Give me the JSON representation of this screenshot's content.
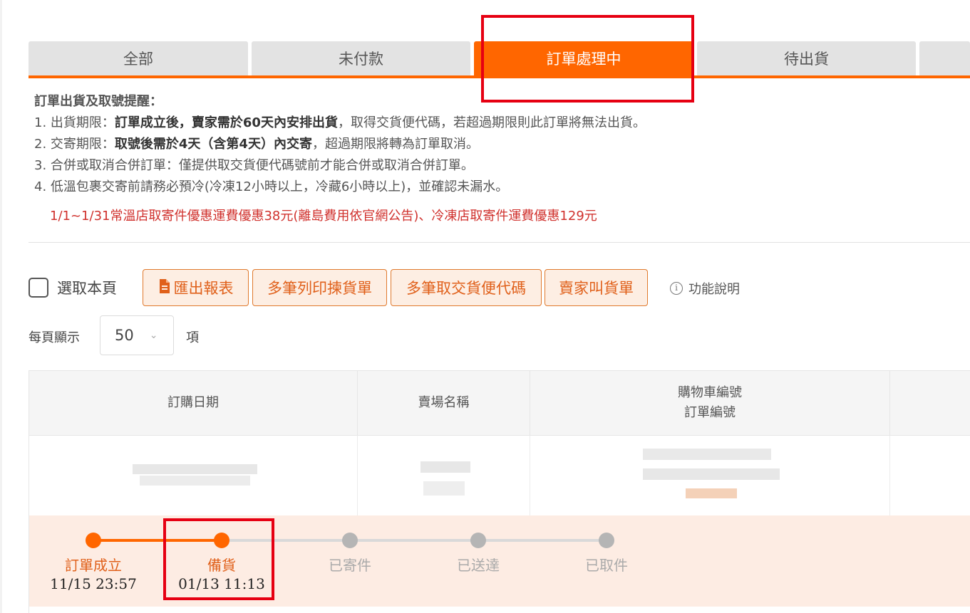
{
  "tabs": [
    {
      "label": "全部"
    },
    {
      "label": "未付款"
    },
    {
      "label": "訂單處理中"
    },
    {
      "label": "待出貨"
    }
  ],
  "notice": {
    "title": "訂單出貨及取號提醒：",
    "lines": [
      {
        "prefix": "1. 出貨期限：",
        "bold": "訂單成立後，賣家需於60天內安排出貨",
        "suffix": "，取得交貨便代碼，若超過期限則此訂單將無法出貨。"
      },
      {
        "prefix": "2. 交寄期限：",
        "bold": "取號後需於4天（含第4天）內交寄",
        "suffix": "，超過期限將轉為訂單取消。"
      },
      {
        "prefix": "3. 合併或取消合併訂單：僅提供取交貨便代碼號前才能合併或取消合併訂單。",
        "bold": "",
        "suffix": ""
      },
      {
        "prefix": "4. 低溫包裹交寄前請務必預冷(冷凍12小時以上，冷藏6小時以上)，並確認未漏水。",
        "bold": "",
        "suffix": ""
      }
    ],
    "promo": "1/1~1/31常溫店取寄件優惠運費優惠38元(離島費用依官網公告)、冷凍店取寄件運費優惠129元"
  },
  "toolbar": {
    "select_page": "選取本頁",
    "export": "匯出報表",
    "print_picking": "多筆列印揀貨單",
    "get_codes": "多筆取交貨便代碼",
    "call_pickup": "賣家叫貨單",
    "help": "功能說明"
  },
  "per_page": {
    "label": "每頁顯示",
    "value": "50",
    "unit": "項"
  },
  "table": {
    "headers": [
      "訂購日期",
      "賣場名稱",
      "購物車編號",
      "訂單編號"
    ]
  },
  "progress": {
    "steps": [
      {
        "label": "訂單成立",
        "time": "11/15 23:57",
        "state": "done"
      },
      {
        "label": "備貨",
        "time": "01/13 11:13",
        "state": "done"
      },
      {
        "label": "已寄件",
        "time": "",
        "state": "pending"
      },
      {
        "label": "已送達",
        "time": "",
        "state": "pending"
      },
      {
        "label": "已取件",
        "time": "",
        "state": "pending"
      }
    ],
    "active_color": "#ff6600",
    "pending_color": "#b5b5b5"
  },
  "colors": {
    "accent": "#ff6600",
    "highlight_box": "#e60012",
    "promo": "#d0312d"
  }
}
